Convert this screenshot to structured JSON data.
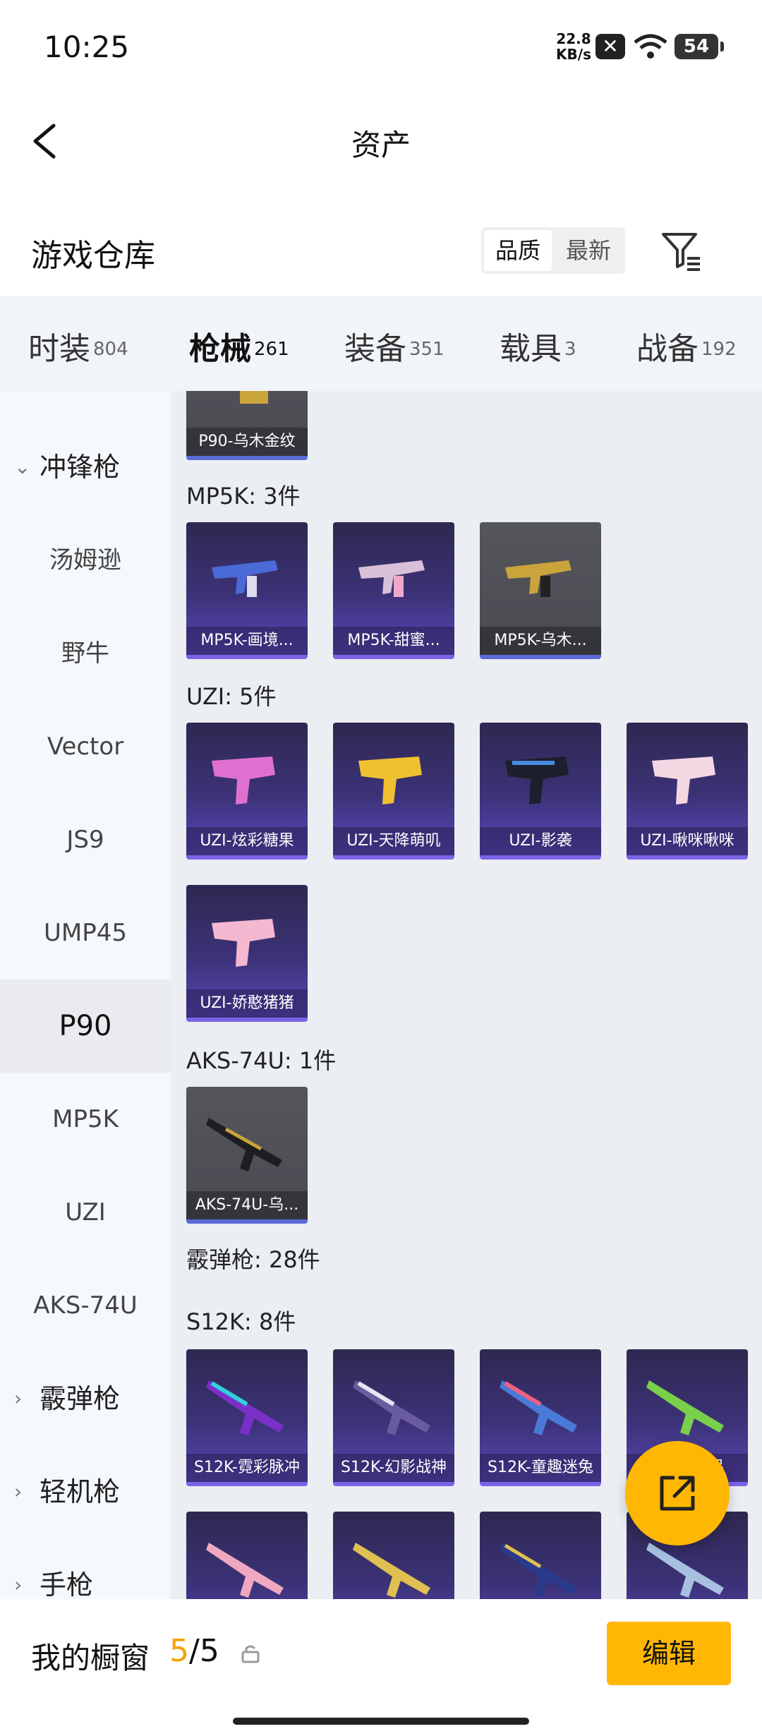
{
  "status": {
    "time": "10:25",
    "speed_value": "22.8",
    "speed_unit": "KB/s",
    "battery": "54"
  },
  "nav": {
    "title": "资产"
  },
  "warehouse": {
    "title": "游戏仓库",
    "sort_quality": "品质",
    "sort_latest": "最新"
  },
  "tabs": [
    {
      "label": "时装",
      "count": "804"
    },
    {
      "label": "枪械",
      "count": "261"
    },
    {
      "label": "装备",
      "count": "351"
    },
    {
      "label": "载具",
      "count": "3"
    },
    {
      "label": "战备",
      "count": "192"
    }
  ],
  "sidebar": {
    "group_smg": "冲锋枪",
    "items": [
      "汤姆逊",
      "野牛",
      "Vector",
      "JS9",
      "UMP45",
      "P90",
      "MP5K",
      "UZI",
      "AKS-74U"
    ],
    "group_shotgun": "霰弹枪",
    "group_lmg": "轻机枪",
    "group_pistol": "手枪"
  },
  "content": {
    "partial_card": "P90-乌木金纹",
    "mp5k_header": "MP5K: 3件",
    "mp5k": [
      "MP5K-画境...",
      "MP5K-甜蜜...",
      "MP5K-乌木..."
    ],
    "uzi_header": "UZI: 5件",
    "uzi": [
      "UZI-炫彩糖果",
      "UZI-天降萌叽",
      "UZI-影袭",
      "UZI-啾咪啾咪",
      "UZI-娇憨猪猪"
    ],
    "aks_header": "AKS-74U: 1件",
    "aks": [
      "AKS-74U-乌..."
    ],
    "shotgun_header": "霰弹枪: 28件",
    "s12k_header": "S12K: 8件",
    "s12k": [
      "S12K-霓彩脉冲",
      "S12K-幻影战神",
      "S12K-童趣迷兔",
      "S12K-...呆"
    ]
  },
  "bottom": {
    "label": "我的橱窗",
    "current": "5",
    "total": "/5",
    "edit": "编辑"
  },
  "colors": {
    "accent": "#ffb703",
    "card_purple": "#3c3278"
  }
}
